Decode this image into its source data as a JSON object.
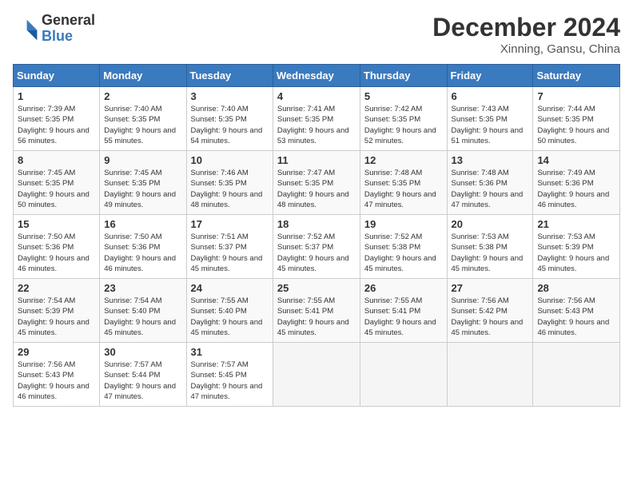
{
  "logo": {
    "line1": "General",
    "line2": "Blue"
  },
  "title": "December 2024",
  "location": "Xinning, Gansu, China",
  "days_of_week": [
    "Sunday",
    "Monday",
    "Tuesday",
    "Wednesday",
    "Thursday",
    "Friday",
    "Saturday"
  ],
  "weeks": [
    [
      {
        "num": "1",
        "rise": "7:39 AM",
        "set": "5:35 PM",
        "daylight": "9 hours and 56 minutes."
      },
      {
        "num": "2",
        "rise": "7:40 AM",
        "set": "5:35 PM",
        "daylight": "9 hours and 55 minutes."
      },
      {
        "num": "3",
        "rise": "7:40 AM",
        "set": "5:35 PM",
        "daylight": "9 hours and 54 minutes."
      },
      {
        "num": "4",
        "rise": "7:41 AM",
        "set": "5:35 PM",
        "daylight": "9 hours and 53 minutes."
      },
      {
        "num": "5",
        "rise": "7:42 AM",
        "set": "5:35 PM",
        "daylight": "9 hours and 52 minutes."
      },
      {
        "num": "6",
        "rise": "7:43 AM",
        "set": "5:35 PM",
        "daylight": "9 hours and 51 minutes."
      },
      {
        "num": "7",
        "rise": "7:44 AM",
        "set": "5:35 PM",
        "daylight": "9 hours and 50 minutes."
      }
    ],
    [
      {
        "num": "8",
        "rise": "7:45 AM",
        "set": "5:35 PM",
        "daylight": "9 hours and 50 minutes."
      },
      {
        "num": "9",
        "rise": "7:45 AM",
        "set": "5:35 PM",
        "daylight": "9 hours and 49 minutes."
      },
      {
        "num": "10",
        "rise": "7:46 AM",
        "set": "5:35 PM",
        "daylight": "9 hours and 48 minutes."
      },
      {
        "num": "11",
        "rise": "7:47 AM",
        "set": "5:35 PM",
        "daylight": "9 hours and 48 minutes."
      },
      {
        "num": "12",
        "rise": "7:48 AM",
        "set": "5:35 PM",
        "daylight": "9 hours and 47 minutes."
      },
      {
        "num": "13",
        "rise": "7:48 AM",
        "set": "5:36 PM",
        "daylight": "9 hours and 47 minutes."
      },
      {
        "num": "14",
        "rise": "7:49 AM",
        "set": "5:36 PM",
        "daylight": "9 hours and 46 minutes."
      }
    ],
    [
      {
        "num": "15",
        "rise": "7:50 AM",
        "set": "5:36 PM",
        "daylight": "9 hours and 46 minutes."
      },
      {
        "num": "16",
        "rise": "7:50 AM",
        "set": "5:36 PM",
        "daylight": "9 hours and 46 minutes."
      },
      {
        "num": "17",
        "rise": "7:51 AM",
        "set": "5:37 PM",
        "daylight": "9 hours and 45 minutes."
      },
      {
        "num": "18",
        "rise": "7:52 AM",
        "set": "5:37 PM",
        "daylight": "9 hours and 45 minutes."
      },
      {
        "num": "19",
        "rise": "7:52 AM",
        "set": "5:38 PM",
        "daylight": "9 hours and 45 minutes."
      },
      {
        "num": "20",
        "rise": "7:53 AM",
        "set": "5:38 PM",
        "daylight": "9 hours and 45 minutes."
      },
      {
        "num": "21",
        "rise": "7:53 AM",
        "set": "5:39 PM",
        "daylight": "9 hours and 45 minutes."
      }
    ],
    [
      {
        "num": "22",
        "rise": "7:54 AM",
        "set": "5:39 PM",
        "daylight": "9 hours and 45 minutes."
      },
      {
        "num": "23",
        "rise": "7:54 AM",
        "set": "5:40 PM",
        "daylight": "9 hours and 45 minutes."
      },
      {
        "num": "24",
        "rise": "7:55 AM",
        "set": "5:40 PM",
        "daylight": "9 hours and 45 minutes."
      },
      {
        "num": "25",
        "rise": "7:55 AM",
        "set": "5:41 PM",
        "daylight": "9 hours and 45 minutes."
      },
      {
        "num": "26",
        "rise": "7:55 AM",
        "set": "5:41 PM",
        "daylight": "9 hours and 45 minutes."
      },
      {
        "num": "27",
        "rise": "7:56 AM",
        "set": "5:42 PM",
        "daylight": "9 hours and 45 minutes."
      },
      {
        "num": "28",
        "rise": "7:56 AM",
        "set": "5:43 PM",
        "daylight": "9 hours and 46 minutes."
      }
    ],
    [
      {
        "num": "29",
        "rise": "7:56 AM",
        "set": "5:43 PM",
        "daylight": "9 hours and 46 minutes."
      },
      {
        "num": "30",
        "rise": "7:57 AM",
        "set": "5:44 PM",
        "daylight": "9 hours and 47 minutes."
      },
      {
        "num": "31",
        "rise": "7:57 AM",
        "set": "5:45 PM",
        "daylight": "9 hours and 47 minutes."
      },
      null,
      null,
      null,
      null
    ]
  ]
}
